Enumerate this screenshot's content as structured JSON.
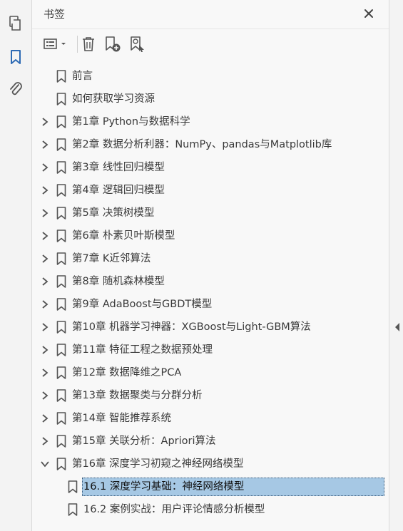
{
  "panel": {
    "title": "书签",
    "close_icon": "close-icon"
  },
  "rail": {
    "icons": [
      "pages-icon",
      "bookmark-icon",
      "attachment-icon"
    ],
    "active": "bookmark-icon"
  },
  "toolbar": {
    "icons": [
      "options-menu-icon",
      "delete-bookmark-icon",
      "new-bookmark-icon",
      "find-bookmark-icon"
    ]
  },
  "colors": {
    "accent": "#2d6ab4",
    "selection": "#a6c8e4"
  },
  "bookmarks": [
    {
      "label": "前言",
      "expandable": false,
      "expanded": false,
      "level": 0
    },
    {
      "label": "如何获取学习资源",
      "expandable": false,
      "expanded": false,
      "level": 0
    },
    {
      "label": "第1章 Python与数据科学",
      "expandable": true,
      "expanded": false,
      "level": 0
    },
    {
      "label": "第2章 数据分析利器：NumPy、pandas与Matplotlib库",
      "expandable": true,
      "expanded": false,
      "level": 0
    },
    {
      "label": "第3章 线性回归模型",
      "expandable": true,
      "expanded": false,
      "level": 0
    },
    {
      "label": "第4章 逻辑回归模型",
      "expandable": true,
      "expanded": false,
      "level": 0
    },
    {
      "label": "第5章 决策树模型",
      "expandable": true,
      "expanded": false,
      "level": 0
    },
    {
      "label": "第6章 朴素贝叶斯模型",
      "expandable": true,
      "expanded": false,
      "level": 0
    },
    {
      "label": "第7章 K近邻算法",
      "expandable": true,
      "expanded": false,
      "level": 0
    },
    {
      "label": "第8章 随机森林模型",
      "expandable": true,
      "expanded": false,
      "level": 0
    },
    {
      "label": "第9章 AdaBoost与GBDT模型",
      "expandable": true,
      "expanded": false,
      "level": 0
    },
    {
      "label": "第10章 机器学习神器：XGBoost与Light-GBM算法",
      "expandable": true,
      "expanded": false,
      "level": 0
    },
    {
      "label": "第11章 特征工程之数据预处理",
      "expandable": true,
      "expanded": false,
      "level": 0
    },
    {
      "label": "第12章 数据降维之PCA",
      "expandable": true,
      "expanded": false,
      "level": 0
    },
    {
      "label": "第13章 数据聚类与分群分析",
      "expandable": true,
      "expanded": false,
      "level": 0
    },
    {
      "label": "第14章 智能推荐系统",
      "expandable": true,
      "expanded": false,
      "level": 0
    },
    {
      "label": "第15章 关联分析：Apriori算法",
      "expandable": true,
      "expanded": false,
      "level": 0
    },
    {
      "label": "第16章 深度学习初窥之神经网络模型",
      "expandable": true,
      "expanded": true,
      "level": 0
    },
    {
      "label": "16.1 深度学习基础：神经网络模型",
      "expandable": false,
      "expanded": false,
      "level": 1,
      "selected": true
    },
    {
      "label": "16.2 案例实战：用户评论情感分析模型",
      "expandable": false,
      "expanded": false,
      "level": 1
    }
  ]
}
